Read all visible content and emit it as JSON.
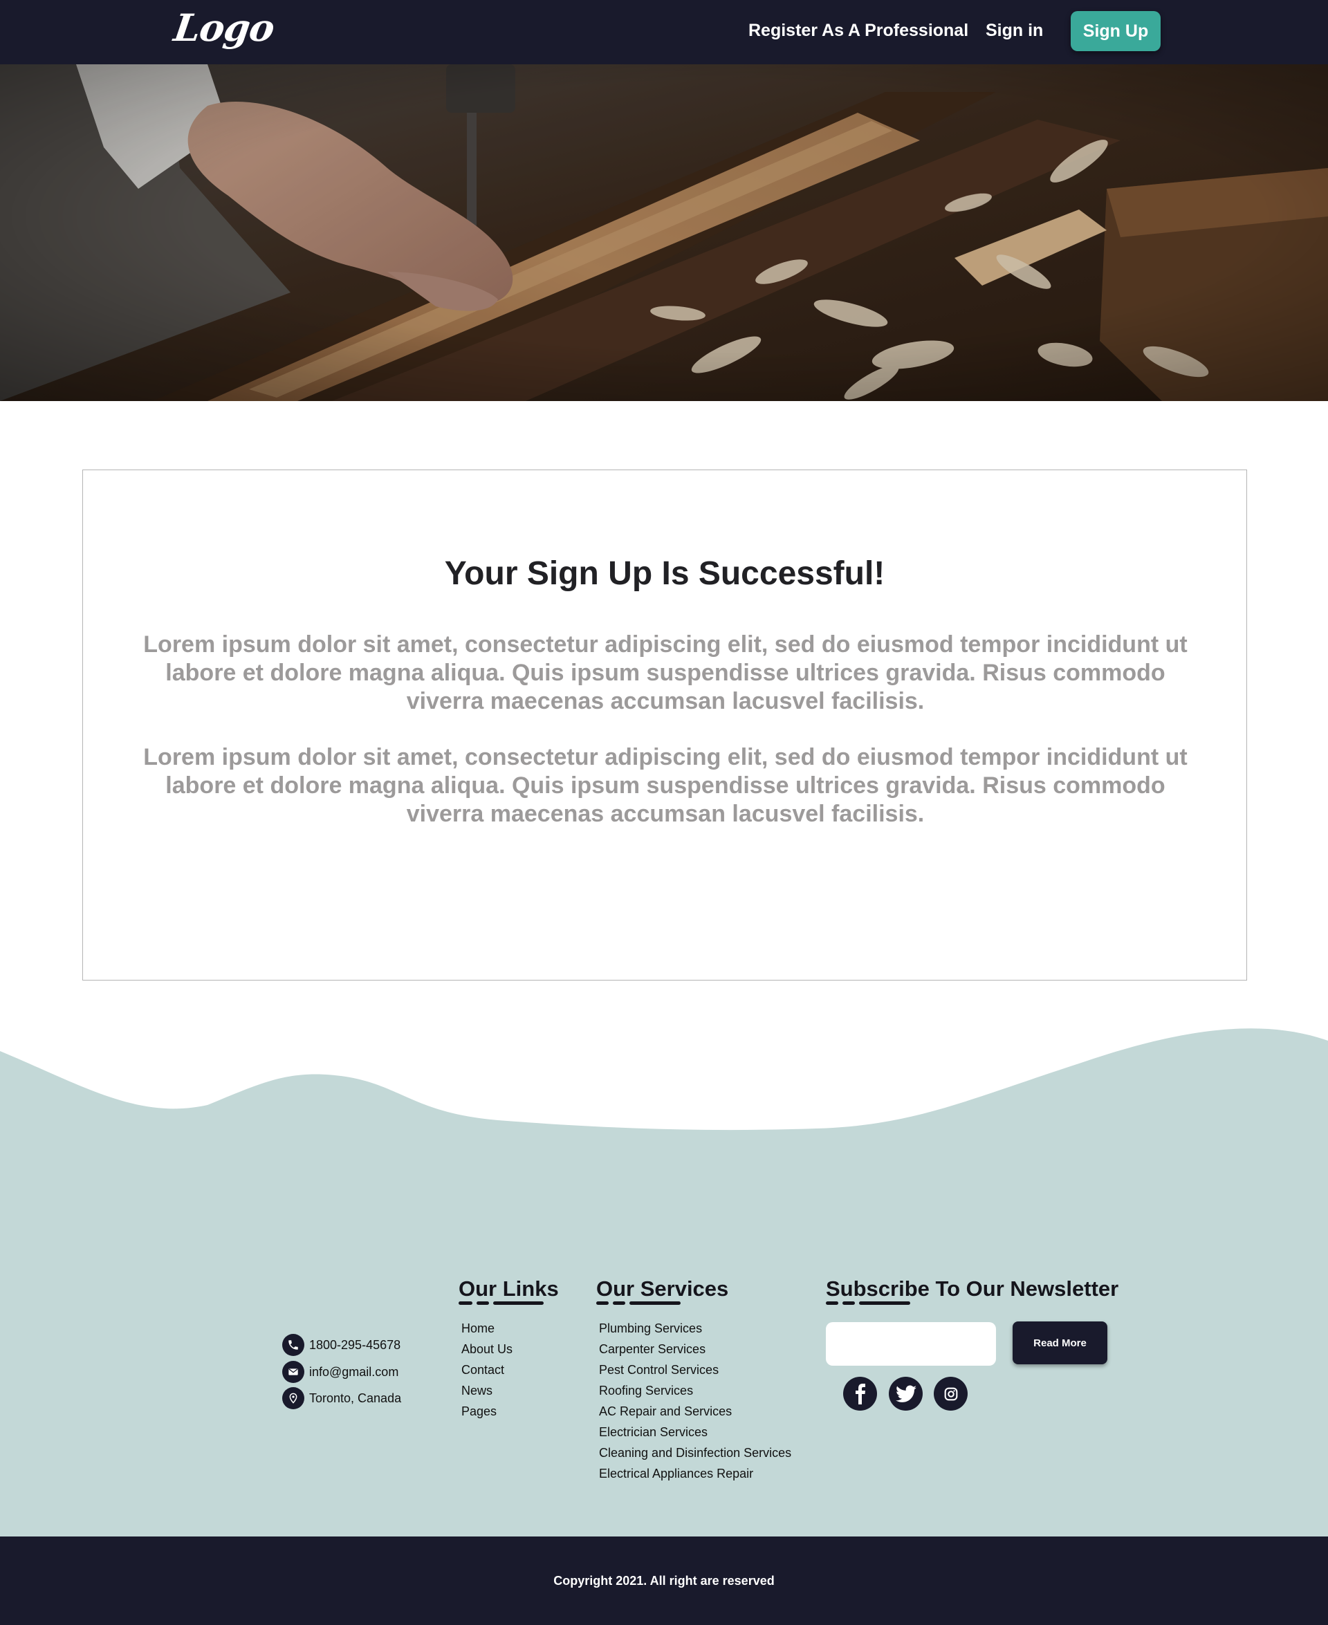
{
  "header": {
    "logo_text": "Logo",
    "nav": {
      "register_label": "Register As A Professional",
      "signin_label": "Sign in",
      "signup_label": "Sign Up"
    }
  },
  "hero": {
    "image_subject": "carpenter working on wooden planks with wood shavings"
  },
  "card": {
    "title": "Your Sign Up Is Successful!",
    "paragraphs": [
      "Lorem ipsum dolor sit amet, consectetur adipiscing elit, sed do eiusmod tempor incididunt ut labore et dolore magna aliqua. Quis ipsum suspendisse ultrices gravida. Risus commodo viverra maecenas accumsan lacusvel facilisis.",
      "Lorem ipsum dolor sit amet, consectetur adipiscing elit, sed do eiusmod tempor incididunt ut labore et dolore magna aliqua. Quis ipsum suspendisse ultrices gravida. Risus commodo viverra maecenas accumsan lacusvel facilisis."
    ]
  },
  "footer": {
    "contact": [
      {
        "icon": "phone-icon",
        "text": "1800-295-45678"
      },
      {
        "icon": "mail-icon",
        "text": "info@gmail.com"
      },
      {
        "icon": "location-pin-icon",
        "text": "Toronto, Canada"
      }
    ],
    "links": {
      "title": "Our Links",
      "items": [
        "Home",
        "About Us",
        "Contact",
        "News",
        "Pages"
      ]
    },
    "services": {
      "title": "Our Services",
      "items": [
        "Plumbing Services",
        "Carpenter Services",
        "Pest Control Services",
        "Roofing Services",
        "AC Repair and Services",
        "Electrician Services",
        "Cleaning and Disinfection Services",
        "Electrical Appliances Repair"
      ]
    },
    "newsletter": {
      "title": "Subscribe To Our Newsletter",
      "input_value": "",
      "button_label": "Read More"
    },
    "social": [
      "facebook-icon",
      "twitter-icon",
      "instagram-icon"
    ],
    "copyright": "Copyright 2021. All right are reserved"
  },
  "colors": {
    "nav_bg": "#191a2c",
    "accent_teal": "#3aa99a",
    "footer_bg": "#c3d8d7",
    "muted_text": "#9c9a9a"
  }
}
